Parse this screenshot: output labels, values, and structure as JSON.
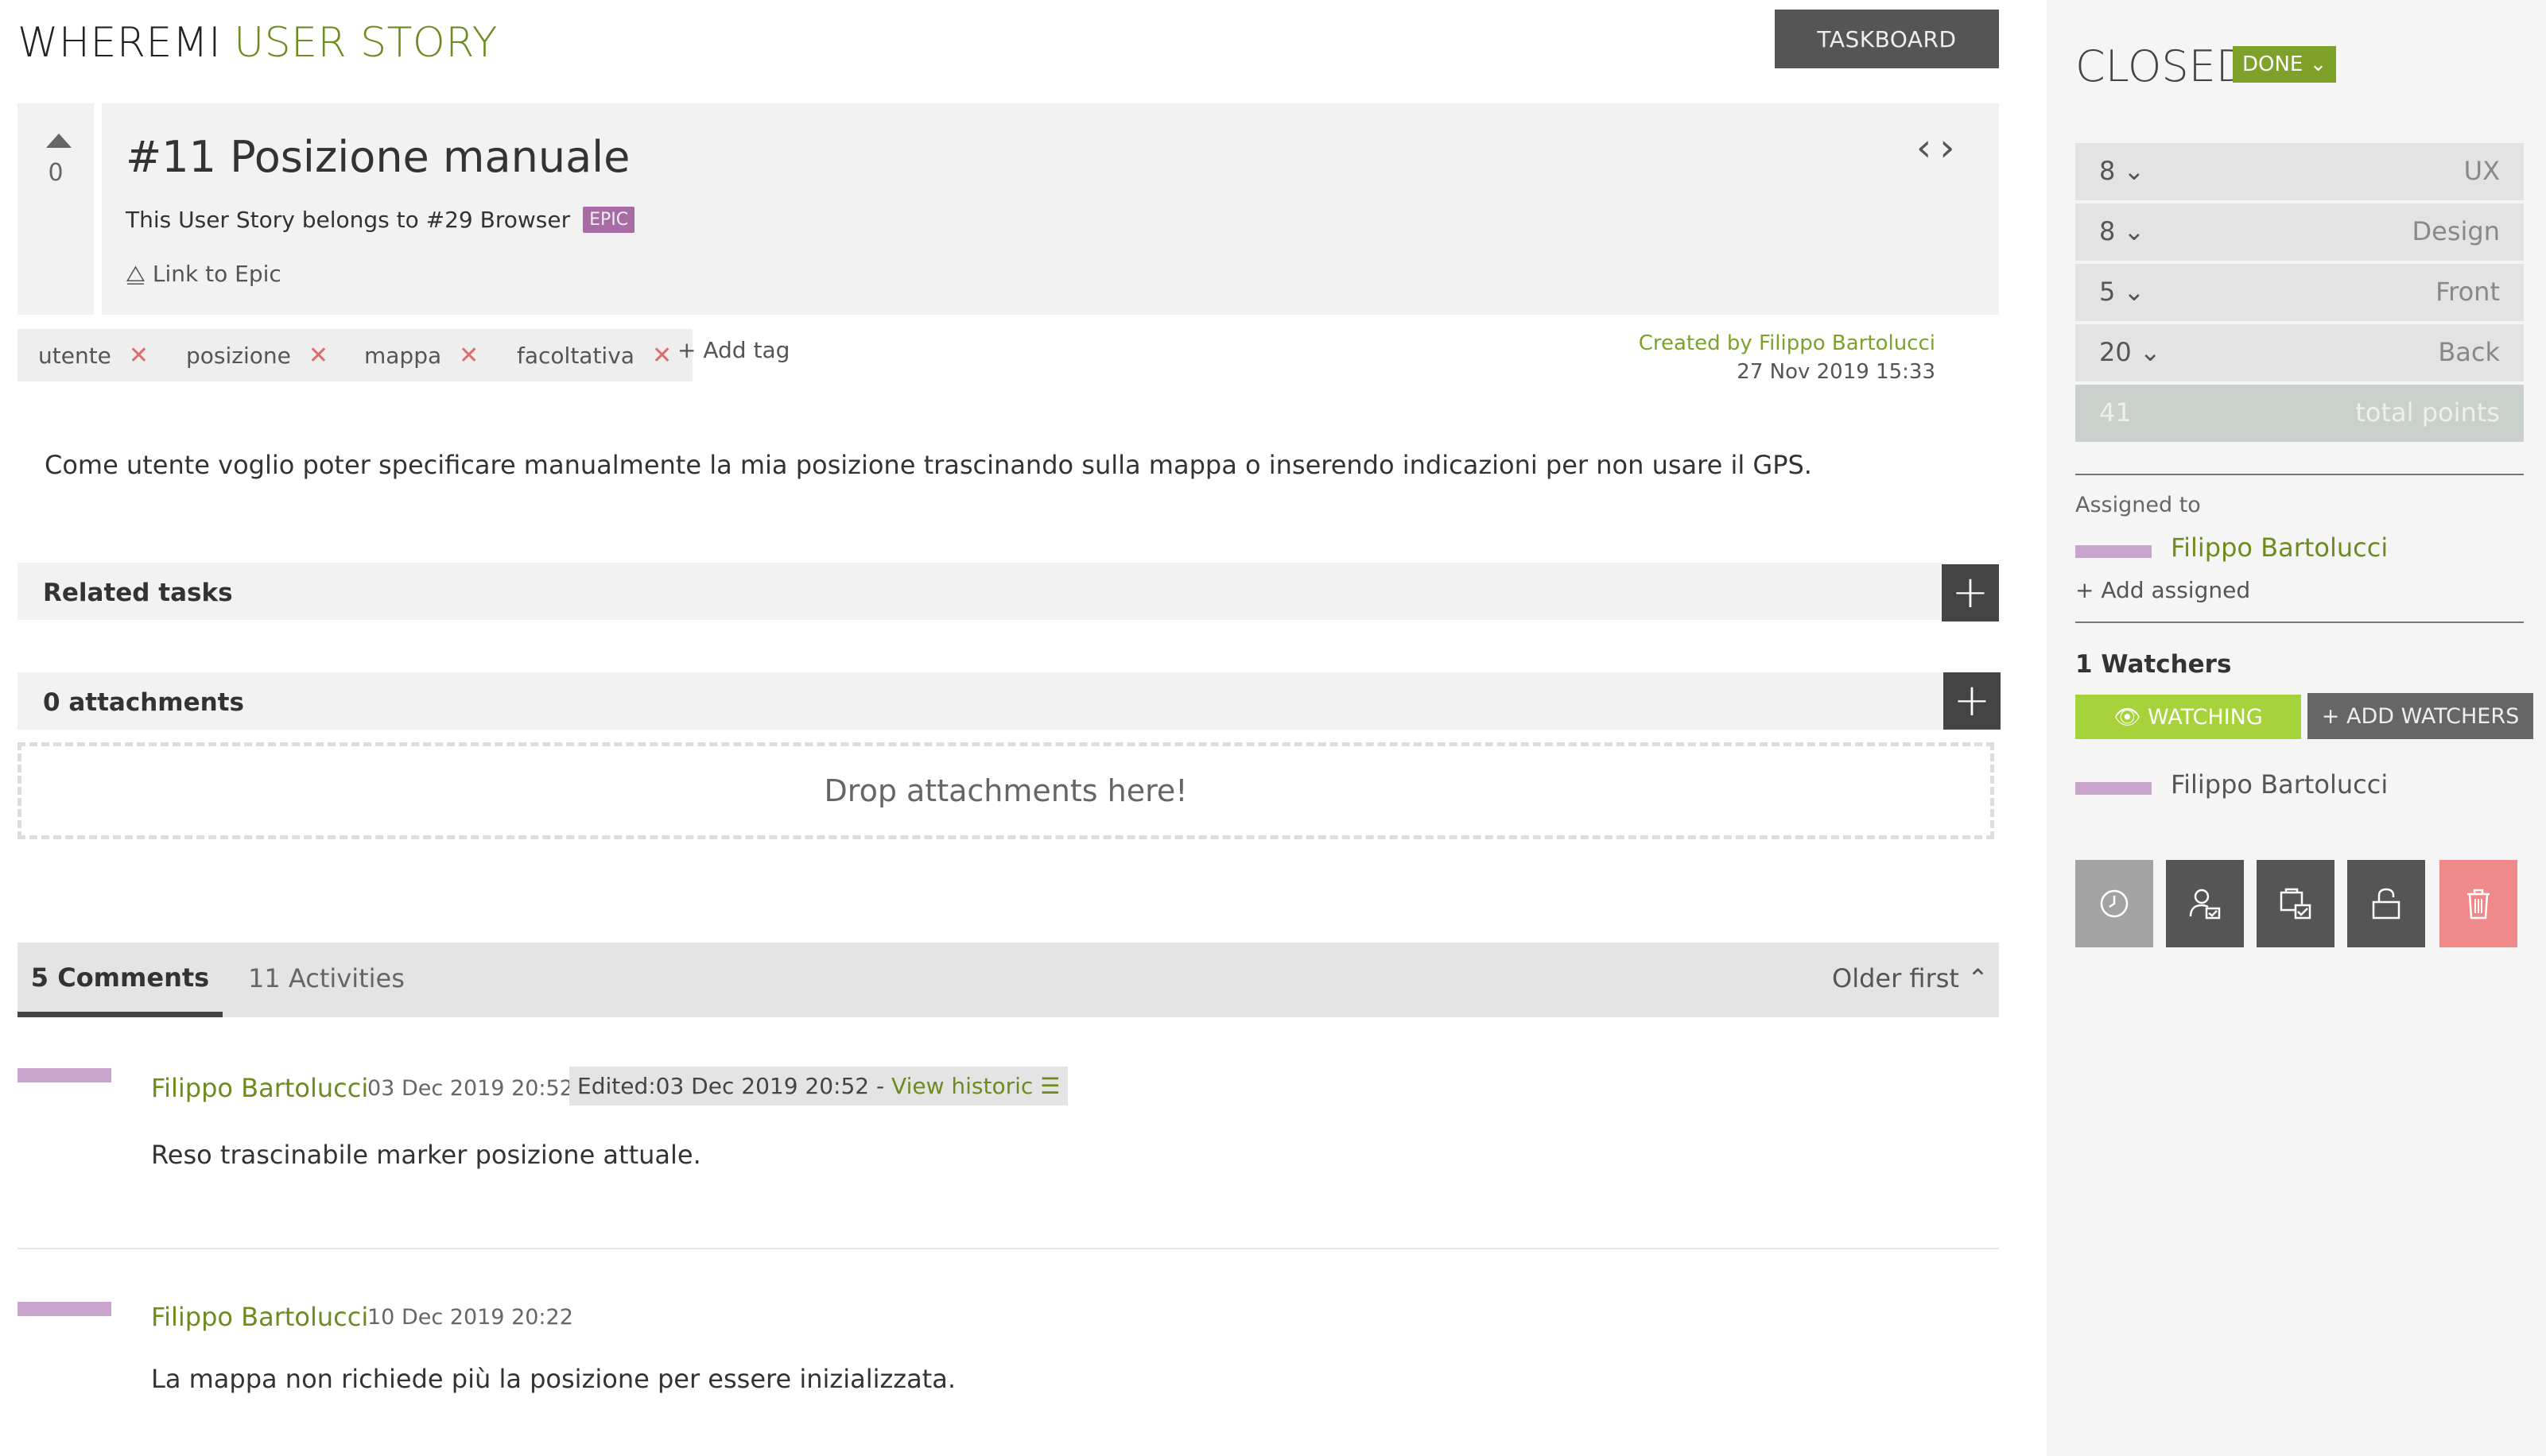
{
  "header": {
    "project": "WHEREMI",
    "section": "USER STORY",
    "taskboard_label": "TASKBOARD"
  },
  "vote": {
    "count": "0",
    "icon": "upvote-arrow-icon"
  },
  "story": {
    "title": "#11 Posizione manuale",
    "epic_text": "This User Story belongs to #29 Browser",
    "epic_badge": "EPIC",
    "link_epic": "⧋ Link to Epic",
    "nav_prev": "‹",
    "nav_next": "›"
  },
  "tags": [
    "utente",
    "posizione",
    "mappa",
    "facoltativa"
  ],
  "tag_remove": "✕",
  "add_tag": "+ Add tag",
  "created": {
    "by": "Created by Filippo Bartolucci",
    "date": "27 Nov 2019 15:33"
  },
  "description": "Come utente voglio poter specificare manualmente la mia posizione trascinando sulla mappa o inserendo indicazioni per non usare il GPS.",
  "related_tasks": {
    "label": "Related tasks",
    "add": "+"
  },
  "attachments": {
    "label": "0 attachments",
    "add": "+",
    "drop": "Drop attachments here!"
  },
  "comments_tabs": {
    "comments": "5 Comments",
    "activities": "11 Activities",
    "order": "Older first ⌃"
  },
  "comments": [
    {
      "author": "Filippo Bartolucci",
      "date": "03 Dec 2019 20:52",
      "edited": "Edited:03 Dec 2019 20:52 - ",
      "view_historic": "View historic ☰",
      "text": "Reso trascinabile marker posizione attuale."
    },
    {
      "author": "Filippo Bartolucci",
      "date": "10 Dec 2019 20:22",
      "text": "La mappa non richiede più la posizione per essere inizializzata."
    }
  ],
  "sidebar": {
    "status": "CLOSED",
    "status_dropdown": "DONE ⌄",
    "points": [
      {
        "value": "8 ⌄",
        "role": "UX"
      },
      {
        "value": "8 ⌄",
        "role": "Design"
      },
      {
        "value": "5 ⌄",
        "role": "Front"
      },
      {
        "value": "20 ⌄",
        "role": "Back"
      }
    ],
    "total": {
      "value": "41",
      "role": "total points"
    },
    "assigned_label": "Assigned to",
    "assigned_name": "Filippo Bartolucci",
    "add_assigned": "+ Add assigned",
    "watchers_count": "1 Watchers",
    "watching_label": "👁 WATCHING",
    "add_watchers_label": "+ ADD WATCHERS",
    "watcher_name": "Filippo Bartolucci",
    "actions": [
      "clock-icon",
      "assign-user-icon",
      "task-check-icon",
      "lock-icon",
      "trash-icon"
    ]
  },
  "colors": {
    "accent_green": "#6f8a1f",
    "done_green": "#7ea12a",
    "watching_green": "#a6d33c",
    "epic_purple": "#a86ba6",
    "avatar_purple": "#c9a4cd",
    "delete_red": "#f08a8a"
  }
}
